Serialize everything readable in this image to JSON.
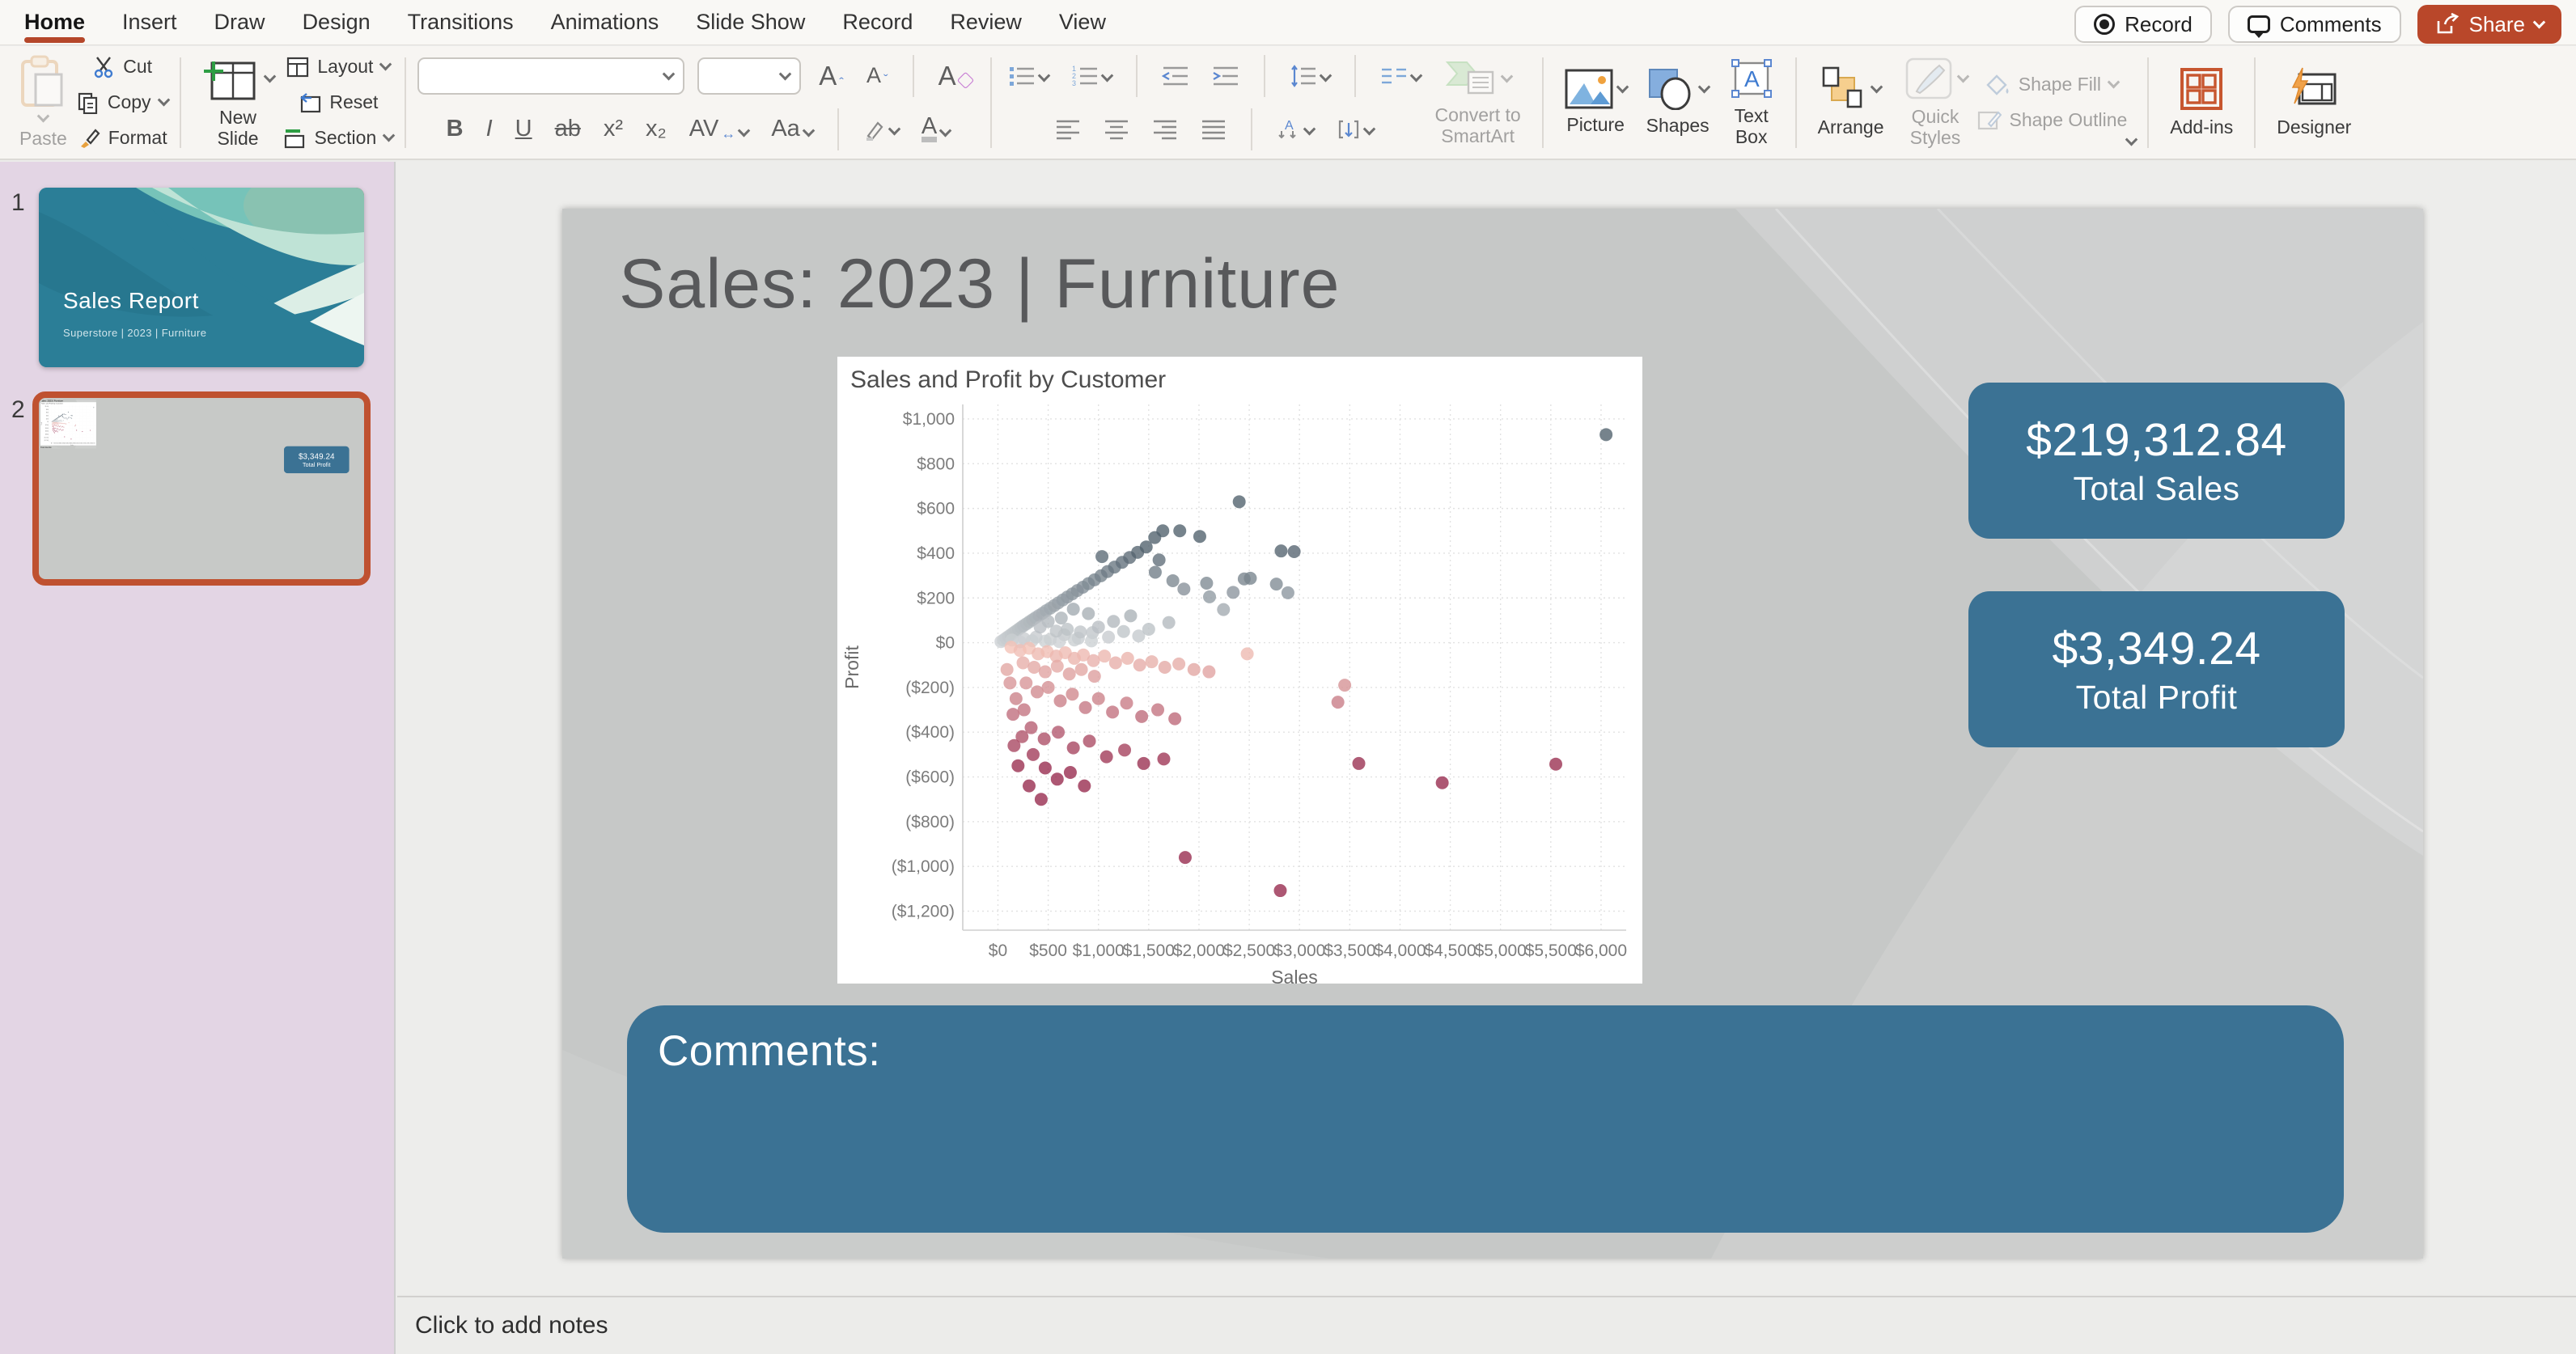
{
  "window": {
    "tabs": [
      {
        "label": "Home",
        "active": true
      },
      {
        "label": "Insert"
      },
      {
        "label": "Draw"
      },
      {
        "label": "Design"
      },
      {
        "label": "Transitions"
      },
      {
        "label": "Animations"
      },
      {
        "label": "Slide Show"
      },
      {
        "label": "Record"
      },
      {
        "label": "Review"
      },
      {
        "label": "View"
      }
    ],
    "actions": {
      "record": "Record",
      "comments": "Comments",
      "share": "Share"
    }
  },
  "ribbon": {
    "paste": "Paste",
    "cut": "Cut",
    "copy": "Copy",
    "format": "Format",
    "new_slide": "New\nSlide",
    "layout": "Layout",
    "reset": "Reset",
    "section": "Section",
    "bold": "B",
    "italic": "I",
    "underline": "U",
    "strike": "ab",
    "superscript": "x²",
    "subscript": "x₂",
    "char_spacing": "AV",
    "change_case": "Aa",
    "grow_font": "A",
    "shrink_font": "A",
    "clear_format": "A",
    "convert_smartart": "Convert to\nSmartArt",
    "picture": "Picture",
    "shapes": "Shapes",
    "text_box": "Text\nBox",
    "arrange": "Arrange",
    "quick_styles": "Quick\nStyles",
    "shape_fill": "Shape Fill",
    "shape_outline": "Shape Outline",
    "add_ins": "Add-ins",
    "designer": "Designer"
  },
  "slides_panel": {
    "slides": [
      {
        "number": "1",
        "title": "Sales Report",
        "subtitle": "Superstore | 2023 | Furniture",
        "selected": false
      },
      {
        "number": "2",
        "selected": true
      }
    ]
  },
  "slide": {
    "title": "Sales: 2023 | Furniture",
    "kpis": [
      {
        "value": "$219,312.84",
        "label": "Total Sales"
      },
      {
        "value": "$3,349.24",
        "label": "Total Profit"
      }
    ],
    "comments_label": "Comments:"
  },
  "notes": {
    "placeholder": "Click to add notes"
  },
  "colors": {
    "share_accent": "#b9472a",
    "tab_underline": "#b5472a",
    "selection_border": "#bf5130",
    "kpi_teal": "#3b7294",
    "slide_bg": "#c6c8c7",
    "panel_lavender": "#e3d5e4",
    "positive_low": "#cdd1d4",
    "positive_high": "#50606c",
    "negative_low": "#f6c7ba",
    "negative_high": "#96284b"
  },
  "chart_data": {
    "type": "scatter",
    "title": "Sales and Profit by Customer",
    "xlabel": "Sales",
    "ylabel": "Profit",
    "x_tick_values": [
      0,
      500,
      1000,
      1500,
      2000,
      2500,
      3000,
      3500,
      4000,
      4500,
      5000,
      5500,
      6000
    ],
    "x_tick_labels": [
      "$0",
      "$500",
      "$1,000",
      "$1,500",
      "$2,000",
      "$2,500",
      "$3,000",
      "$3,500",
      "$4,000",
      "$4,500",
      "$5,000",
      "$5,500",
      "$6,000"
    ],
    "y_tick_values": [
      1000,
      800,
      600,
      400,
      200,
      0,
      -200,
      -400,
      -600,
      -800,
      -1000,
      -1200
    ],
    "y_tick_labels": [
      "$1,000",
      "$800",
      "$600",
      "$400",
      "$200",
      "$0",
      "($200)",
      "($400)",
      "($600)",
      "($800)",
      "($1,000)",
      "($1,200)"
    ],
    "xlim": [
      -350,
      6250
    ],
    "ylim": [
      -1285,
      1065
    ],
    "grid": true,
    "legend": false,
    "point_radius": 8,
    "color_encoding": "profit: diverging scale, gray-blue = positive, red = negative",
    "points": [
      [
        30,
        5
      ],
      [
        55,
        12
      ],
      [
        80,
        20
      ],
      [
        105,
        28
      ],
      [
        130,
        36
      ],
      [
        155,
        44
      ],
      [
        180,
        52
      ],
      [
        205,
        60
      ],
      [
        230,
        68
      ],
      [
        255,
        76
      ],
      [
        285,
        85
      ],
      [
        315,
        94
      ],
      [
        345,
        103
      ],
      [
        375,
        112
      ],
      [
        410,
        122
      ],
      [
        445,
        132
      ],
      [
        480,
        143
      ],
      [
        520,
        154
      ],
      [
        560,
        166
      ],
      [
        600,
        178
      ],
      [
        645,
        191
      ],
      [
        690,
        204
      ],
      [
        740,
        218
      ],
      [
        790,
        233
      ],
      [
        845,
        248
      ],
      [
        900,
        264
      ],
      [
        960,
        281
      ],
      [
        1025,
        299
      ],
      [
        1090,
        318
      ],
      [
        1160,
        338
      ],
      [
        1235,
        359
      ],
      [
        1310,
        381
      ],
      [
        1390,
        404
      ],
      [
        1475,
        428
      ],
      [
        1560,
        470
      ],
      [
        1640,
        500
      ],
      [
        1809,
        500
      ],
      [
        2008,
        475
      ],
      [
        2400,
        630
      ],
      [
        2511,
        288
      ],
      [
        2817,
        410
      ],
      [
        2947,
        407
      ],
      [
        2885,
        223
      ],
      [
        2450,
        285
      ],
      [
        2770,
        262
      ],
      [
        2105,
        205
      ],
      [
        2340,
        225
      ],
      [
        1565,
        315
      ],
      [
        1035,
        385
      ],
      [
        1740,
        277
      ],
      [
        1603,
        370
      ],
      [
        2244,
        148
      ],
      [
        2076,
        266
      ],
      [
        6050,
        930
      ],
      [
        140,
        12
      ],
      [
        260,
        18
      ],
      [
        380,
        25
      ],
      [
        520,
        15
      ],
      [
        660,
        35
      ],
      [
        800,
        20
      ],
      [
        940,
        45
      ],
      [
        1100,
        25
      ],
      [
        1250,
        50
      ],
      [
        1400,
        30
      ],
      [
        220,
        4
      ],
      [
        340,
        9
      ],
      [
        470,
        7
      ],
      [
        610,
        5
      ],
      [
        760,
        12
      ],
      [
        930,
        8
      ],
      [
        1500,
        60
      ],
      [
        580,
        52
      ],
      [
        690,
        60
      ],
      [
        820,
        48
      ],
      [
        1000,
        70
      ],
      [
        1150,
        95
      ],
      [
        1320,
        120
      ],
      [
        900,
        130
      ],
      [
        750,
        150
      ],
      [
        630,
        110
      ],
      [
        500,
        95
      ],
      [
        420,
        70
      ],
      [
        1700,
        90
      ],
      [
        1850,
        240
      ],
      [
        130,
        -20
      ],
      [
        220,
        -35
      ],
      [
        310,
        -25
      ],
      [
        400,
        -50
      ],
      [
        490,
        -40
      ],
      [
        580,
        -60
      ],
      [
        670,
        -45
      ],
      [
        760,
        -70
      ],
      [
        850,
        -55
      ],
      [
        950,
        -80
      ],
      [
        1060,
        -60
      ],
      [
        1170,
        -90
      ],
      [
        1290,
        -70
      ],
      [
        1410,
        -100
      ],
      [
        1530,
        -85
      ],
      [
        1660,
        -110
      ],
      [
        1800,
        -95
      ],
      [
        1950,
        -120
      ],
      [
        2480,
        -50
      ],
      [
        2100,
        -130
      ],
      [
        250,
        -90
      ],
      [
        360,
        -110
      ],
      [
        470,
        -130
      ],
      [
        590,
        -105
      ],
      [
        710,
        -140
      ],
      [
        830,
        -120
      ],
      [
        960,
        -150
      ],
      [
        280,
        -180
      ],
      [
        390,
        -220
      ],
      [
        500,
        -200
      ],
      [
        620,
        -260
      ],
      [
        740,
        -230
      ],
      [
        870,
        -290
      ],
      [
        1000,
        -250
      ],
      [
        1140,
        -310
      ],
      [
        1280,
        -270
      ],
      [
        1430,
        -330
      ],
      [
        1590,
        -300
      ],
      [
        3382,
        -266
      ],
      [
        3450,
        -190
      ],
      [
        1760,
        -340
      ],
      [
        330,
        -380
      ],
      [
        460,
        -430
      ],
      [
        600,
        -400
      ],
      [
        750,
        -470
      ],
      [
        910,
        -440
      ],
      [
        1080,
        -510
      ],
      [
        1260,
        -480
      ],
      [
        1450,
        -540
      ],
      [
        3590,
        -540
      ],
      [
        4420,
        -626
      ],
      [
        5550,
        -543
      ],
      [
        1650,
        -520
      ],
      [
        150,
        -320
      ],
      [
        240,
        -420
      ],
      [
        350,
        -500
      ],
      [
        470,
        -560
      ],
      [
        590,
        -610
      ],
      [
        720,
        -580
      ],
      [
        860,
        -640
      ],
      [
        200,
        -550
      ],
      [
        310,
        -640
      ],
      [
        430,
        -700
      ],
      [
        180,
        -250
      ],
      [
        260,
        -300
      ],
      [
        120,
        -180
      ],
      [
        90,
        -120
      ],
      [
        160,
        -460
      ],
      [
        1863,
        -960
      ],
      [
        2809,
        -1108
      ]
    ]
  }
}
